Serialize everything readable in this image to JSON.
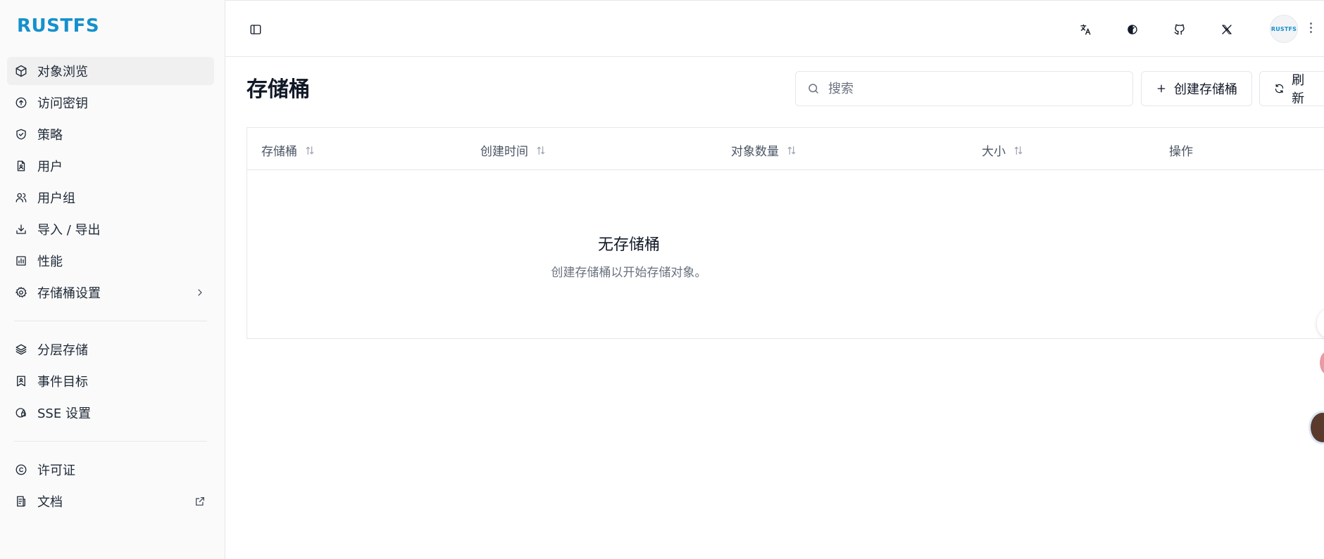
{
  "brand": {
    "logo_text": "RUSTFS",
    "accent": "#1590cd"
  },
  "sidebar": {
    "groups": [
      [
        {
          "label": "对象浏览",
          "icon": "box-icon",
          "active": true
        },
        {
          "label": "访问密钥",
          "icon": "key-circle-icon"
        },
        {
          "label": "策略",
          "icon": "shield-check-icon"
        },
        {
          "label": "用户",
          "icon": "user-file-icon"
        },
        {
          "label": "用户组",
          "icon": "users-icon"
        },
        {
          "label": "导入 / 导出",
          "icon": "download-tray-icon"
        },
        {
          "label": "性能",
          "icon": "bar-chart-icon"
        },
        {
          "label": "存储桶设置",
          "icon": "gear-icon",
          "trail": "chevron-right-icon"
        }
      ],
      [
        {
          "label": "分层存储",
          "icon": "layers-icon"
        },
        {
          "label": "事件目标",
          "icon": "bookmark-user-icon"
        },
        {
          "label": "SSE 设置",
          "icon": "lock-shield-icon"
        }
      ],
      [
        {
          "label": "许可证",
          "icon": "copyright-icon"
        },
        {
          "label": "文档",
          "icon": "document-list-icon",
          "trail": "external-link-icon"
        }
      ]
    ]
  },
  "topbar": {
    "toggle_icon": "sidebar-toggle-icon",
    "actions": [
      "translate-icon",
      "theme-icon",
      "github-icon",
      "x-logo-icon"
    ],
    "avatar_text": "RUSTFS"
  },
  "main": {
    "title": "存储桶",
    "search": {
      "placeholder": "搜索",
      "value": ""
    },
    "create_label": "创建存储桶",
    "refresh_label": "刷新",
    "columns": [
      {
        "label": "存储桶",
        "sortable": true
      },
      {
        "label": "创建时间",
        "sortable": true
      },
      {
        "label": "对象数量",
        "sortable": true
      },
      {
        "label": "大小",
        "sortable": true
      },
      {
        "label": "操作",
        "sortable": false
      }
    ],
    "empty": {
      "title": "无存储桶",
      "subtitle": "创建存储桶以开始存储对象。"
    }
  }
}
